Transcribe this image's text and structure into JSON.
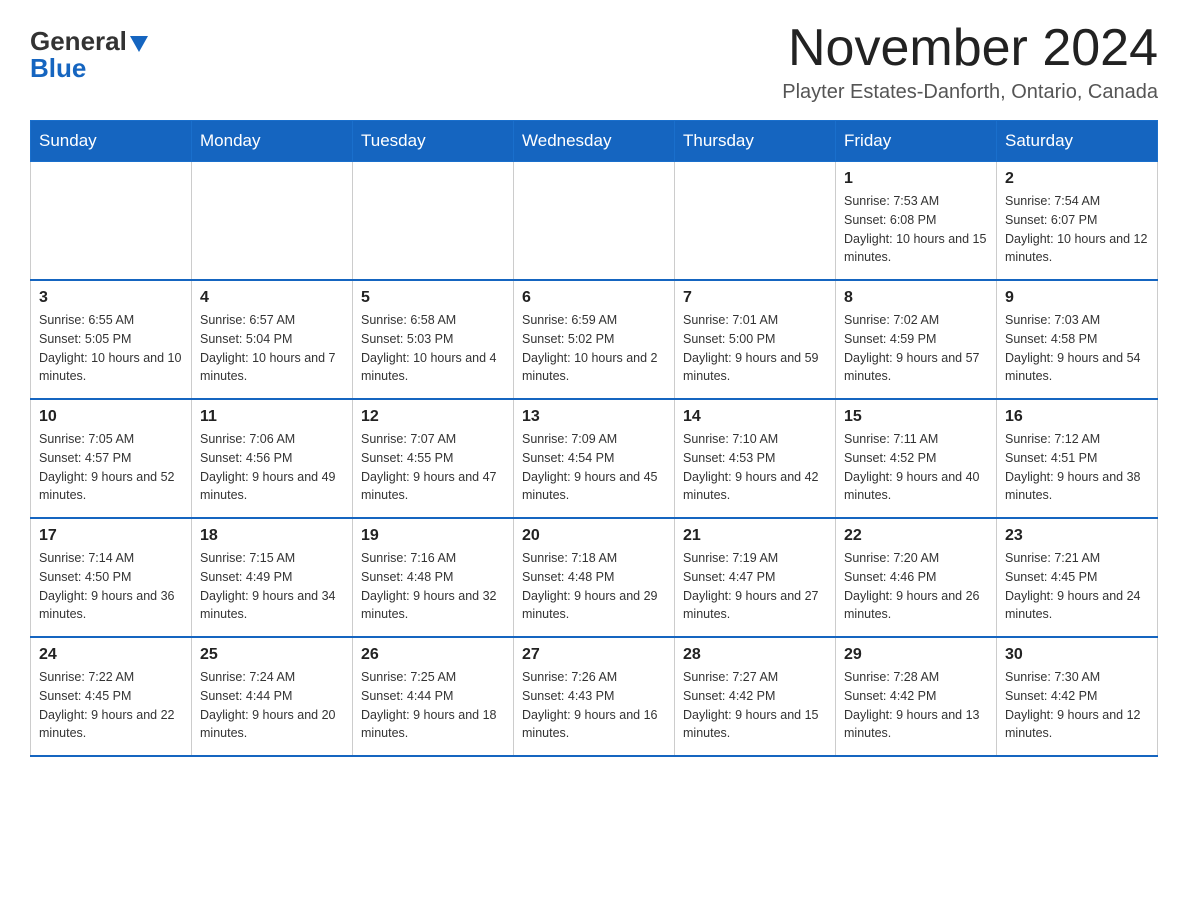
{
  "logo": {
    "general": "General",
    "triangle": "▲",
    "blue": "Blue"
  },
  "header": {
    "month_year": "November 2024",
    "location": "Playter Estates-Danforth, Ontario, Canada"
  },
  "days_of_week": [
    "Sunday",
    "Monday",
    "Tuesday",
    "Wednesday",
    "Thursday",
    "Friday",
    "Saturday"
  ],
  "weeks": [
    [
      {
        "day": "",
        "info": ""
      },
      {
        "day": "",
        "info": ""
      },
      {
        "day": "",
        "info": ""
      },
      {
        "day": "",
        "info": ""
      },
      {
        "day": "",
        "info": ""
      },
      {
        "day": "1",
        "info": "Sunrise: 7:53 AM\nSunset: 6:08 PM\nDaylight: 10 hours and 15 minutes."
      },
      {
        "day": "2",
        "info": "Sunrise: 7:54 AM\nSunset: 6:07 PM\nDaylight: 10 hours and 12 minutes."
      }
    ],
    [
      {
        "day": "3",
        "info": "Sunrise: 6:55 AM\nSunset: 5:05 PM\nDaylight: 10 hours and 10 minutes."
      },
      {
        "day": "4",
        "info": "Sunrise: 6:57 AM\nSunset: 5:04 PM\nDaylight: 10 hours and 7 minutes."
      },
      {
        "day": "5",
        "info": "Sunrise: 6:58 AM\nSunset: 5:03 PM\nDaylight: 10 hours and 4 minutes."
      },
      {
        "day": "6",
        "info": "Sunrise: 6:59 AM\nSunset: 5:02 PM\nDaylight: 10 hours and 2 minutes."
      },
      {
        "day": "7",
        "info": "Sunrise: 7:01 AM\nSunset: 5:00 PM\nDaylight: 9 hours and 59 minutes."
      },
      {
        "day": "8",
        "info": "Sunrise: 7:02 AM\nSunset: 4:59 PM\nDaylight: 9 hours and 57 minutes."
      },
      {
        "day": "9",
        "info": "Sunrise: 7:03 AM\nSunset: 4:58 PM\nDaylight: 9 hours and 54 minutes."
      }
    ],
    [
      {
        "day": "10",
        "info": "Sunrise: 7:05 AM\nSunset: 4:57 PM\nDaylight: 9 hours and 52 minutes."
      },
      {
        "day": "11",
        "info": "Sunrise: 7:06 AM\nSunset: 4:56 PM\nDaylight: 9 hours and 49 minutes."
      },
      {
        "day": "12",
        "info": "Sunrise: 7:07 AM\nSunset: 4:55 PM\nDaylight: 9 hours and 47 minutes."
      },
      {
        "day": "13",
        "info": "Sunrise: 7:09 AM\nSunset: 4:54 PM\nDaylight: 9 hours and 45 minutes."
      },
      {
        "day": "14",
        "info": "Sunrise: 7:10 AM\nSunset: 4:53 PM\nDaylight: 9 hours and 42 minutes."
      },
      {
        "day": "15",
        "info": "Sunrise: 7:11 AM\nSunset: 4:52 PM\nDaylight: 9 hours and 40 minutes."
      },
      {
        "day": "16",
        "info": "Sunrise: 7:12 AM\nSunset: 4:51 PM\nDaylight: 9 hours and 38 minutes."
      }
    ],
    [
      {
        "day": "17",
        "info": "Sunrise: 7:14 AM\nSunset: 4:50 PM\nDaylight: 9 hours and 36 minutes."
      },
      {
        "day": "18",
        "info": "Sunrise: 7:15 AM\nSunset: 4:49 PM\nDaylight: 9 hours and 34 minutes."
      },
      {
        "day": "19",
        "info": "Sunrise: 7:16 AM\nSunset: 4:48 PM\nDaylight: 9 hours and 32 minutes."
      },
      {
        "day": "20",
        "info": "Sunrise: 7:18 AM\nSunset: 4:48 PM\nDaylight: 9 hours and 29 minutes."
      },
      {
        "day": "21",
        "info": "Sunrise: 7:19 AM\nSunset: 4:47 PM\nDaylight: 9 hours and 27 minutes."
      },
      {
        "day": "22",
        "info": "Sunrise: 7:20 AM\nSunset: 4:46 PM\nDaylight: 9 hours and 26 minutes."
      },
      {
        "day": "23",
        "info": "Sunrise: 7:21 AM\nSunset: 4:45 PM\nDaylight: 9 hours and 24 minutes."
      }
    ],
    [
      {
        "day": "24",
        "info": "Sunrise: 7:22 AM\nSunset: 4:45 PM\nDaylight: 9 hours and 22 minutes."
      },
      {
        "day": "25",
        "info": "Sunrise: 7:24 AM\nSunset: 4:44 PM\nDaylight: 9 hours and 20 minutes."
      },
      {
        "day": "26",
        "info": "Sunrise: 7:25 AM\nSunset: 4:44 PM\nDaylight: 9 hours and 18 minutes."
      },
      {
        "day": "27",
        "info": "Sunrise: 7:26 AM\nSunset: 4:43 PM\nDaylight: 9 hours and 16 minutes."
      },
      {
        "day": "28",
        "info": "Sunrise: 7:27 AM\nSunset: 4:42 PM\nDaylight: 9 hours and 15 minutes."
      },
      {
        "day": "29",
        "info": "Sunrise: 7:28 AM\nSunset: 4:42 PM\nDaylight: 9 hours and 13 minutes."
      },
      {
        "day": "30",
        "info": "Sunrise: 7:30 AM\nSunset: 4:42 PM\nDaylight: 9 hours and 12 minutes."
      }
    ]
  ]
}
